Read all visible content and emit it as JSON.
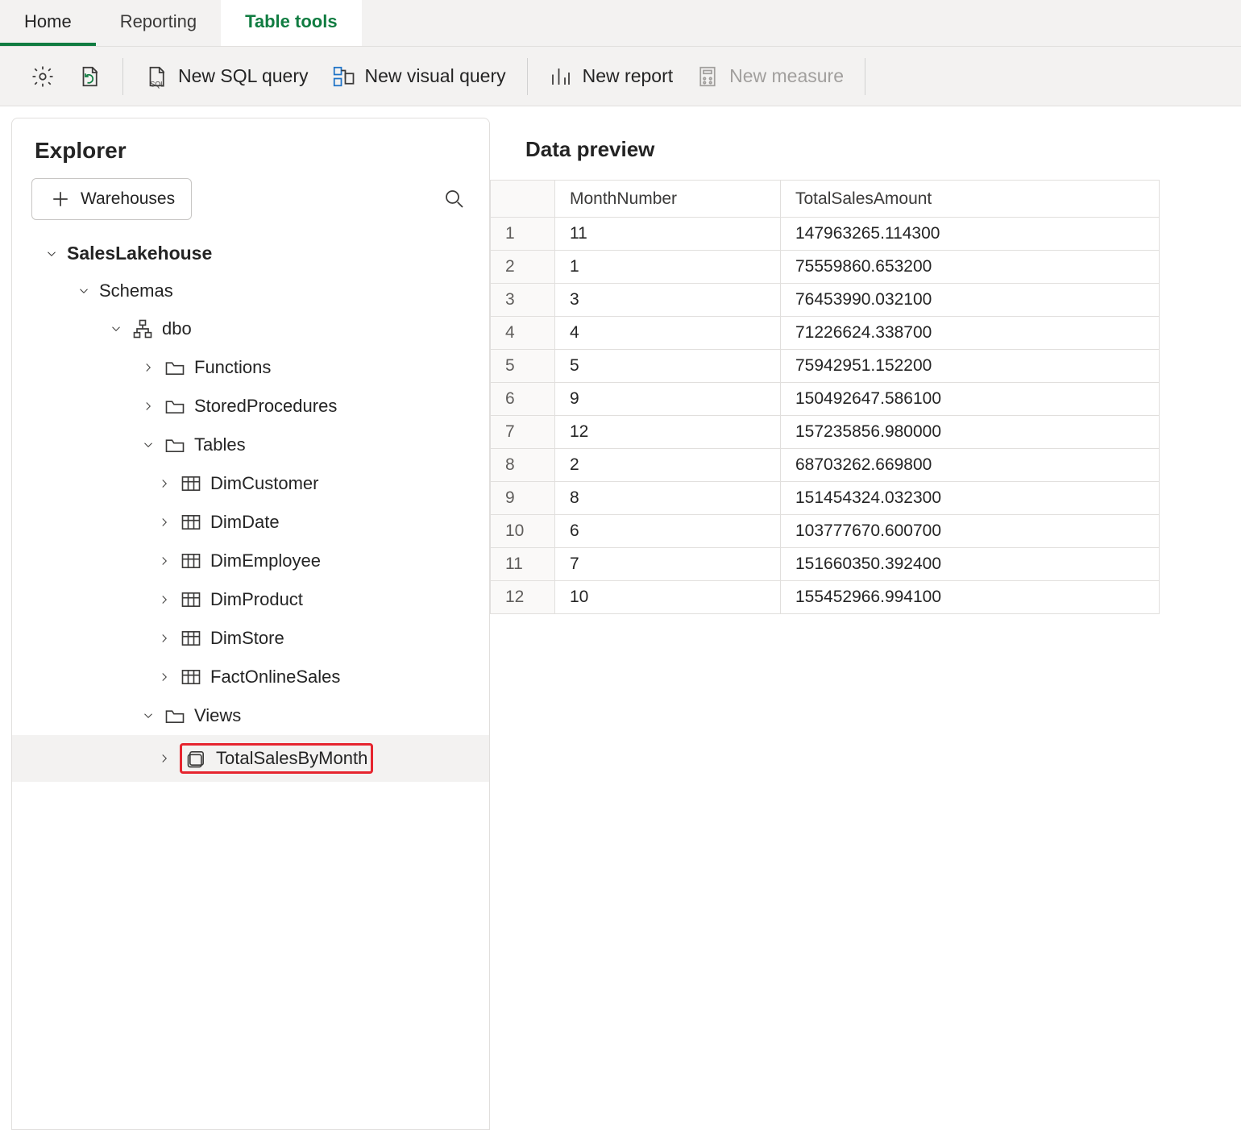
{
  "tabs": {
    "home": "Home",
    "reporting": "Reporting",
    "table_tools": "Table tools"
  },
  "toolbar": {
    "new_sql_query": "New SQL query",
    "new_visual_query": "New visual query",
    "new_report": "New report",
    "new_measure": "New measure"
  },
  "explorer": {
    "title": "Explorer",
    "warehouses_button": "Warehouses",
    "root": "SalesLakehouse",
    "schemas": "Schemas",
    "schema_dbo": "dbo",
    "functions": "Functions",
    "stored_procedures": "StoredProcedures",
    "tables": "Tables",
    "tables_items": {
      "0": "DimCustomer",
      "1": "DimDate",
      "2": "DimEmployee",
      "3": "DimProduct",
      "4": "DimStore",
      "5": "FactOnlineSales"
    },
    "views": "Views",
    "view_selected": "TotalSalesByMonth"
  },
  "preview": {
    "title": "Data preview",
    "columns": {
      "0": "MonthNumber",
      "1": "TotalSalesAmount"
    },
    "rows": [
      {
        "n": "1",
        "c0": "11",
        "c1": "147963265.114300"
      },
      {
        "n": "2",
        "c0": "1",
        "c1": "75559860.653200"
      },
      {
        "n": "3",
        "c0": "3",
        "c1": "76453990.032100"
      },
      {
        "n": "4",
        "c0": "4",
        "c1": "71226624.338700"
      },
      {
        "n": "5",
        "c0": "5",
        "c1": "75942951.152200"
      },
      {
        "n": "6",
        "c0": "9",
        "c1": "150492647.586100"
      },
      {
        "n": "7",
        "c0": "12",
        "c1": "157235856.980000"
      },
      {
        "n": "8",
        "c0": "2",
        "c1": "68703262.669800"
      },
      {
        "n": "9",
        "c0": "8",
        "c1": "151454324.032300"
      },
      {
        "n": "10",
        "c0": "6",
        "c1": "103777670.600700"
      },
      {
        "n": "11",
        "c0": "7",
        "c1": "151660350.392400"
      },
      {
        "n": "12",
        "c0": "10",
        "c1": "155452966.994100"
      }
    ]
  }
}
